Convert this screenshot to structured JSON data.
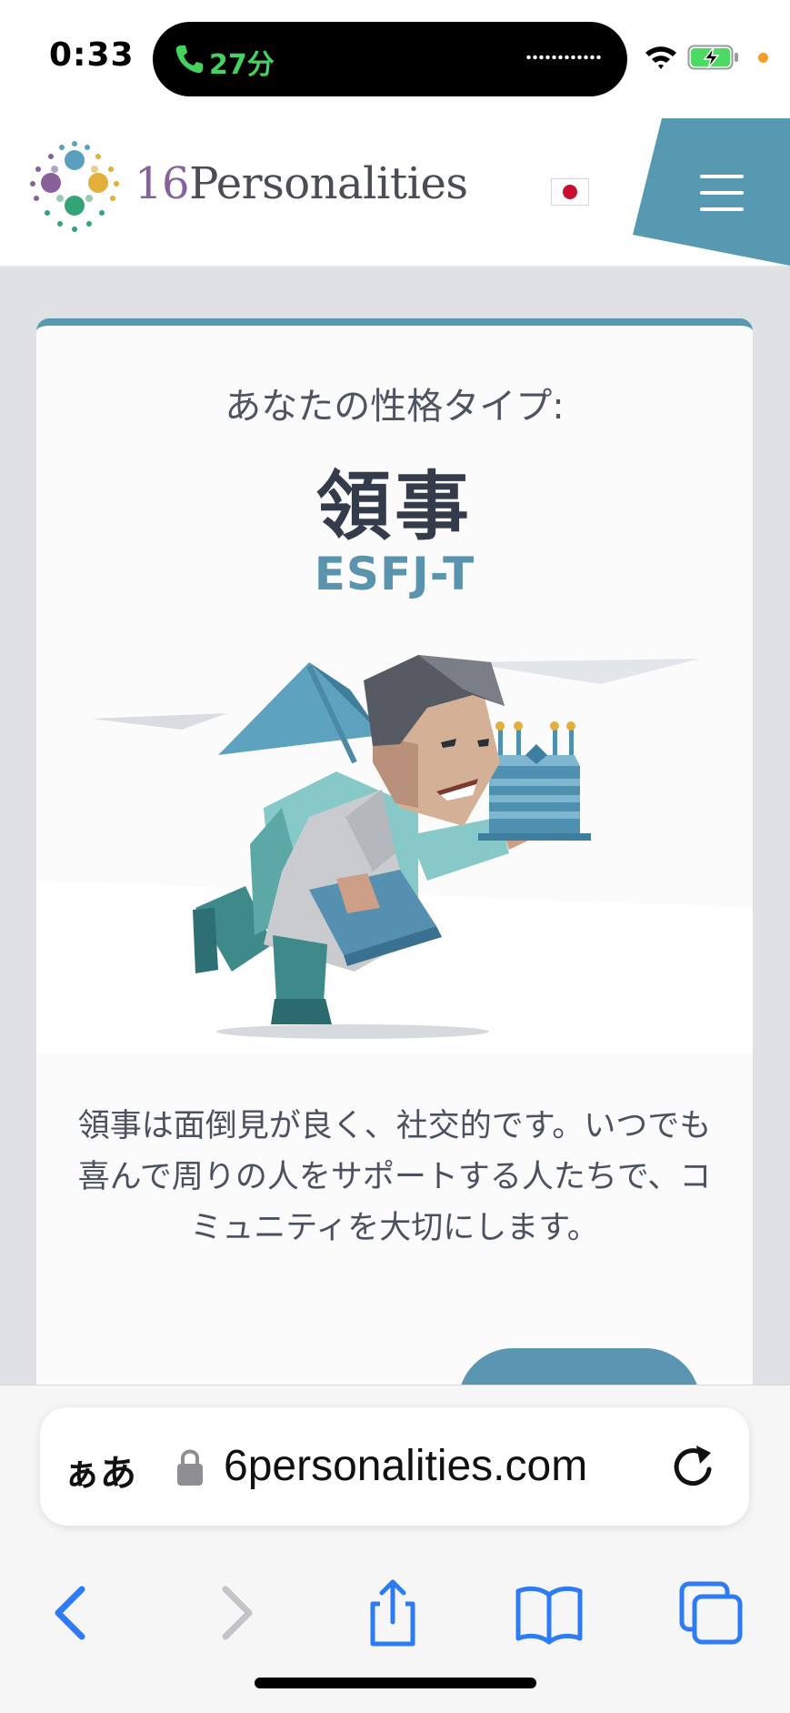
{
  "status_bar": {
    "time": "0:33",
    "call_duration": "27分",
    "call_color": "#44d35f",
    "icons": [
      "phone-icon",
      "wifi-icon",
      "battery-charging-icon",
      "privacy-dot"
    ]
  },
  "header": {
    "logo_number": "16",
    "logo_word": "Personalities",
    "language_flag": "jp-flag-icon",
    "menu_icon": "hamburger-menu-icon",
    "accent_color": "#5899b2"
  },
  "result": {
    "label": "あなたの性格タイプ:",
    "type_name": "領事",
    "type_code": "ESFJ-T",
    "illustration": "consul-character-with-cake-illustration",
    "description": "領事は面倒見が良く、社交的です。いつでも喜んで周りの人をサポートする人たちで、コミュニティを大切にします。"
  },
  "browser": {
    "aa_label": "ぁあ",
    "url": "6personalities.com",
    "icons": [
      "lock-icon",
      "reload-icon",
      "back-icon",
      "forward-icon",
      "share-icon",
      "bookmarks-icon",
      "tabs-icon"
    ],
    "accent_color": "#2d7cf6"
  }
}
